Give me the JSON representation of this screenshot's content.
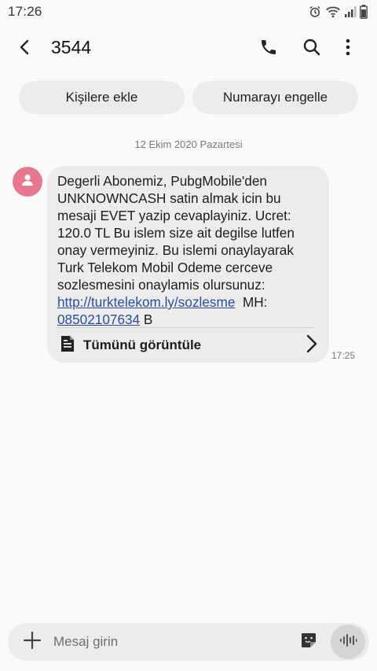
{
  "status_bar": {
    "time": "17:26"
  },
  "app_bar": {
    "title": "3544"
  },
  "actions": {
    "add_contact_label": "Kişilere ekle",
    "block_number_label": "Numarayı engelle"
  },
  "conversation": {
    "date": "12 Ekim 2020 Pazartesi",
    "message": {
      "text_before_link": "Degerli Abonemiz, PubgMobile'den\nUNKNOWNCASH satin almak icin bu\nmesaji EVET yazip cevaplayiniz. Ucret:\n120.0 TL Bu islem size ait degilse lutfen\nonay vermeyiniz. Bu islemi onaylayarak\nTurk Telekom Mobil Odeme cerceve\nsozlesmesini onaylamis olursunuz:\n",
      "link_url": "http://turktelekom.ly/sozlesme",
      "text_mid": "  MH:\n",
      "phone_link": "08502107634",
      "text_after": " B",
      "view_all_label": "Tümünü görüntüle",
      "time": "17:25"
    }
  },
  "composer": {
    "placeholder": "Mesaj girin"
  },
  "colors": {
    "avatar": "#e8788f",
    "bubble": "#ececec",
    "link": "#2a4f9f",
    "background": "#fafafa"
  }
}
